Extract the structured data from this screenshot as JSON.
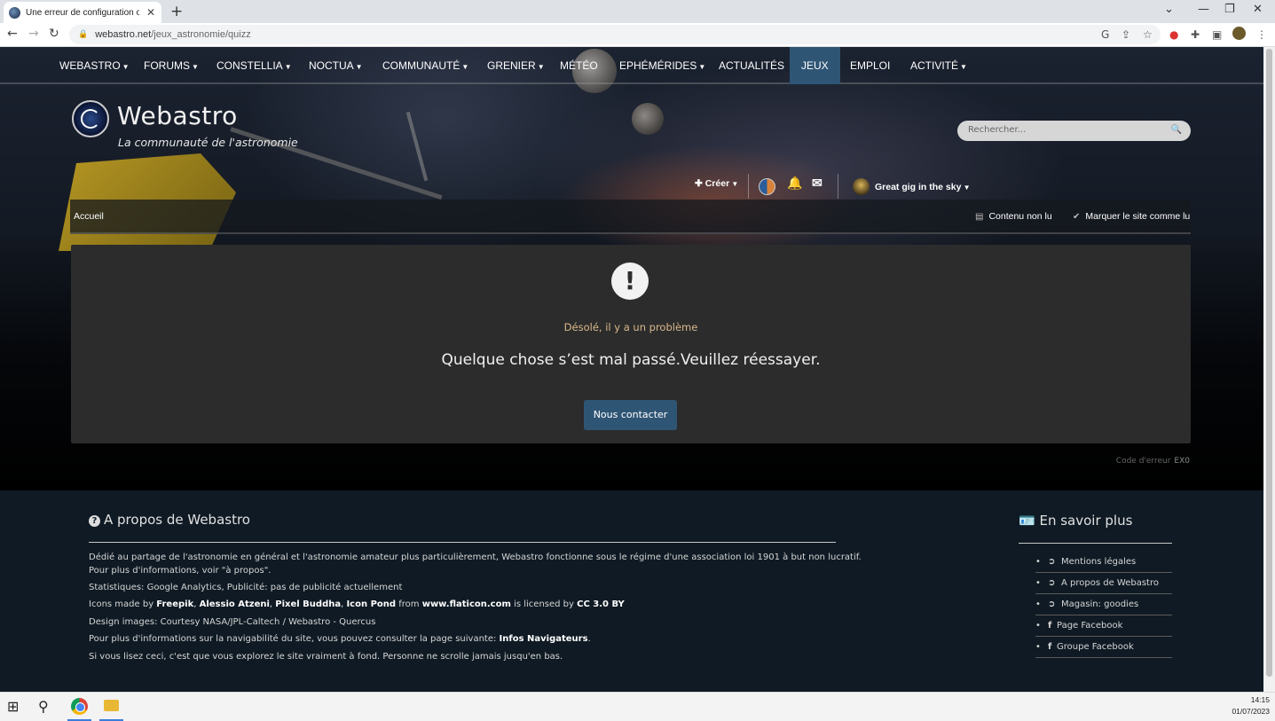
{
  "browser": {
    "tab_title": "Une erreur de configuration ou u",
    "url_host": "webastro.net",
    "url_path": "/jeux_astronomie/quizz"
  },
  "nav": {
    "items": [
      {
        "label": "WEBASTRO",
        "caret": true
      },
      {
        "label": "FORUMS",
        "caret": true
      },
      {
        "label": "CONSTELLIA",
        "caret": true
      },
      {
        "label": "NOCTUA",
        "caret": true
      },
      {
        "label": "COMMUNAUTÉ",
        "caret": true
      },
      {
        "label": "GRENIER",
        "caret": true
      },
      {
        "label": "MÉTÉO",
        "caret": false
      },
      {
        "label": "EPHÉMÉRIDES",
        "caret": true
      },
      {
        "label": "ACTUALITÉS",
        "caret": false
      },
      {
        "label": "JEUX",
        "caret": false,
        "active": true
      },
      {
        "label": "EMPLOI",
        "caret": false
      },
      {
        "label": "ACTIVITÉ",
        "caret": true
      }
    ]
  },
  "brand": {
    "title": "Webastro",
    "tagline": "La communauté de l'astronomie"
  },
  "search": {
    "placeholder": "Rechercher..."
  },
  "user": {
    "create_label": "Créer",
    "username": "Great gig in the sky"
  },
  "subnav": {
    "home": "Accueil",
    "unread": "Contenu non lu",
    "mark_read": "Marquer le site comme lu"
  },
  "error": {
    "subtitle": "Désolé, il y a un problème",
    "message": "Quelque chose s’est mal passé.Veuillez réessayer.",
    "button": "Nous contacter",
    "code_label": "Code d'erreur",
    "code": "EX0"
  },
  "footer": {
    "about_title": "A propos de Webastro",
    "line1": "Dédié au partage de l'astronomie en général et l'astronomie amateur plus particulièrement, Webastro fonctionne sous le régime d'une association loi 1901 à but non lucratif.",
    "line2": "Pour plus d'informations, voir \"à propos\".",
    "stats": "Statistiques:   Google Analytics, Publicité: pas de publicité actuellement",
    "icons_prefix": "Icons made by ",
    "icons_authors": [
      "Freepik",
      "Alessio Atzeni",
      "Pixel Buddha",
      "Icon Pond"
    ],
    "icons_from": " from ",
    "icons_site": "www.flaticon.com",
    "icons_licensed": " is licensed by ",
    "icons_license": "CC 3.0 BY",
    "design": "Design images: Courtesy NASA/JPL-Caltech / Webastro - Quercus",
    "nav_prefix": "Pour plus d'informations sur la navigabilité du site, vous pouvez consulter la page suivante: ",
    "nav_link": "Infos Navigateurs",
    "nav_suffix": ".",
    "easter": "Si vous lisez ceci, c'est que vous explorez le site vraiment à fond. Personne ne scrolle jamais jusqu'en bas.",
    "more_title": "En savoir plus",
    "links": [
      {
        "icon": "arrow-circle-icon",
        "label": "Mentions légales"
      },
      {
        "icon": "arrow-circle-icon",
        "label": "A propos de Webastro"
      },
      {
        "icon": "arrow-circle-icon",
        "label": "Magasin: goodies"
      },
      {
        "icon": "facebook-icon",
        "label": "Page Facebook"
      },
      {
        "icon": "facebook-icon",
        "label": "Groupe Facebook"
      }
    ]
  },
  "taskbar": {
    "time": "14:15",
    "date": "01/07/2023"
  }
}
